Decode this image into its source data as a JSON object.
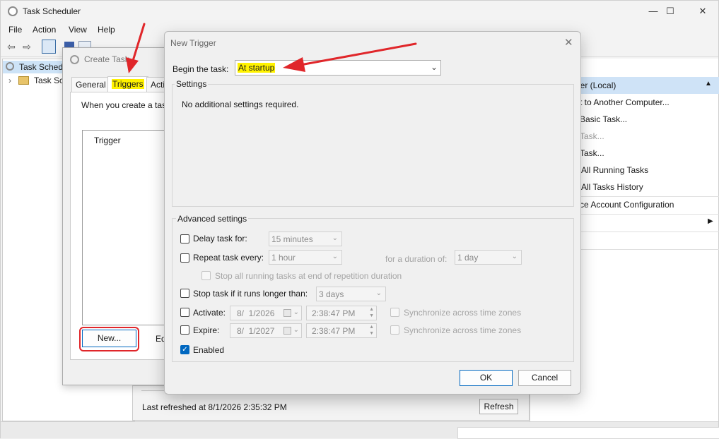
{
  "main_window": {
    "title": "Task Scheduler",
    "caption_buttons": {
      "minimize": "—",
      "maximize": "☐",
      "close": "✕"
    },
    "menu": [
      "File",
      "Action",
      "View",
      "Help"
    ],
    "tree": [
      "Task Scheduler (Local)",
      "Task Scheduler Library"
    ],
    "tree_visible": [
      "Task Schedu",
      "Task Sch"
    ],
    "status": {
      "last_refreshed": "Last refreshed at 8/1/2026 2:35:32 PM",
      "refresh_label": "Refresh"
    },
    "actions_pane": {
      "header": "ler (Local)",
      "items": [
        "t to Another Computer...",
        "Basic Task...",
        "Task...",
        "Task...",
        "All Running Tasks",
        "All Tasks History",
        "ce Account Configuration"
      ]
    }
  },
  "create_task": {
    "title": "Create Task",
    "tabs": [
      "General",
      "Triggers",
      "Acti"
    ],
    "info": "When you create a task",
    "list_header": "Trigger",
    "new_label": "New...",
    "edit_label": "Ed"
  },
  "new_trigger": {
    "title": "New Trigger",
    "close_glyph": "✕",
    "begin_label": "Begin the task:",
    "begin_value": "At startup",
    "settings_label": "Settings",
    "settings_text": "No additional settings required.",
    "advanced_label": "Advanced settings",
    "delay": {
      "label": "Delay task for:",
      "value": "15 minutes",
      "checked": false
    },
    "repeat": {
      "label": "Repeat task every:",
      "value": "1 hour",
      "checked": false,
      "duration_label": "for a duration of:",
      "duration_value": "1 day"
    },
    "stop_running": {
      "label": "Stop all running tasks at end of repetition duration",
      "checked": false
    },
    "stop_longer": {
      "label": "Stop task if it runs longer than:",
      "value": "3 days",
      "checked": false
    },
    "activate": {
      "label": "Activate:",
      "date": "8/  1/2026",
      "time": "2:38:47 PM",
      "checked": false,
      "sync_label": "Synchronize across time zones"
    },
    "expire": {
      "label": "Expire:",
      "date": "8/  1/2027",
      "time": "2:38:47 PM",
      "checked": false,
      "sync_label": "Synchronize across time zones"
    },
    "enabled": {
      "label": "Enabled",
      "checked": true
    },
    "ok_label": "OK",
    "cancel_label": "Cancel"
  },
  "colors": {
    "highlight": "#fff200",
    "annotation_red": "#e0262a",
    "accent_blue": "#0067c0"
  }
}
